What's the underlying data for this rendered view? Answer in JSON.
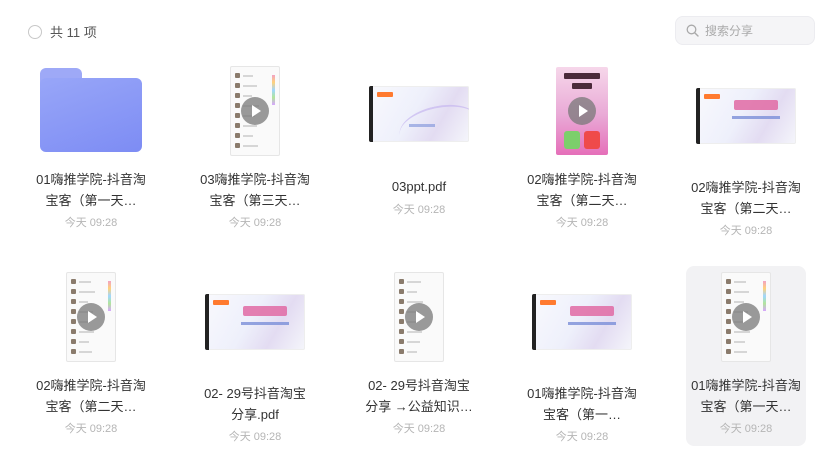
{
  "header": {
    "count_label": "共 11 项",
    "search_placeholder": "搜索分享"
  },
  "files": [
    {
      "name": "01嗨推学院-抖音淘宝客（第一天…",
      "time": "今天 09:28",
      "thumb": "folder",
      "selected": false
    },
    {
      "name": "03嗨推学院-抖音淘宝客（第三天…",
      "time": "今天 09:28",
      "thumb": "chat-video",
      "selected": false
    },
    {
      "name": "03ppt.pdf",
      "time": "今天 09:28",
      "thumb": "slide",
      "selected": false
    },
    {
      "name": "02嗨推学院-抖音淘宝客（第二天…",
      "time": "今天 09:28",
      "thumb": "poster-video",
      "selected": false
    },
    {
      "name": "02嗨推学院-抖音淘宝客（第二天…",
      "time": "今天 09:28",
      "thumb": "slide",
      "selected": false
    },
    {
      "name": "02嗨推学院-抖音淘宝客（第二天…",
      "time": "今天 09:28",
      "thumb": "chat-video",
      "selected": false
    },
    {
      "name": "02- 29号抖音淘宝分享.pdf",
      "time": "今天 09:28",
      "thumb": "slide",
      "selected": false
    },
    {
      "name": "02- 29号抖音淘宝分享 →公益知识…",
      "time": "今天 09:28",
      "thumb": "chat-video",
      "selected": false
    },
    {
      "name": "01嗨推学院-抖音淘宝客（第一…",
      "time": "今天 09:28",
      "thumb": "slide",
      "selected": false
    },
    {
      "name": "01嗨推学院-抖音淘宝客（第一天…",
      "time": "今天 09:28",
      "thumb": "chat-video",
      "selected": true
    }
  ]
}
